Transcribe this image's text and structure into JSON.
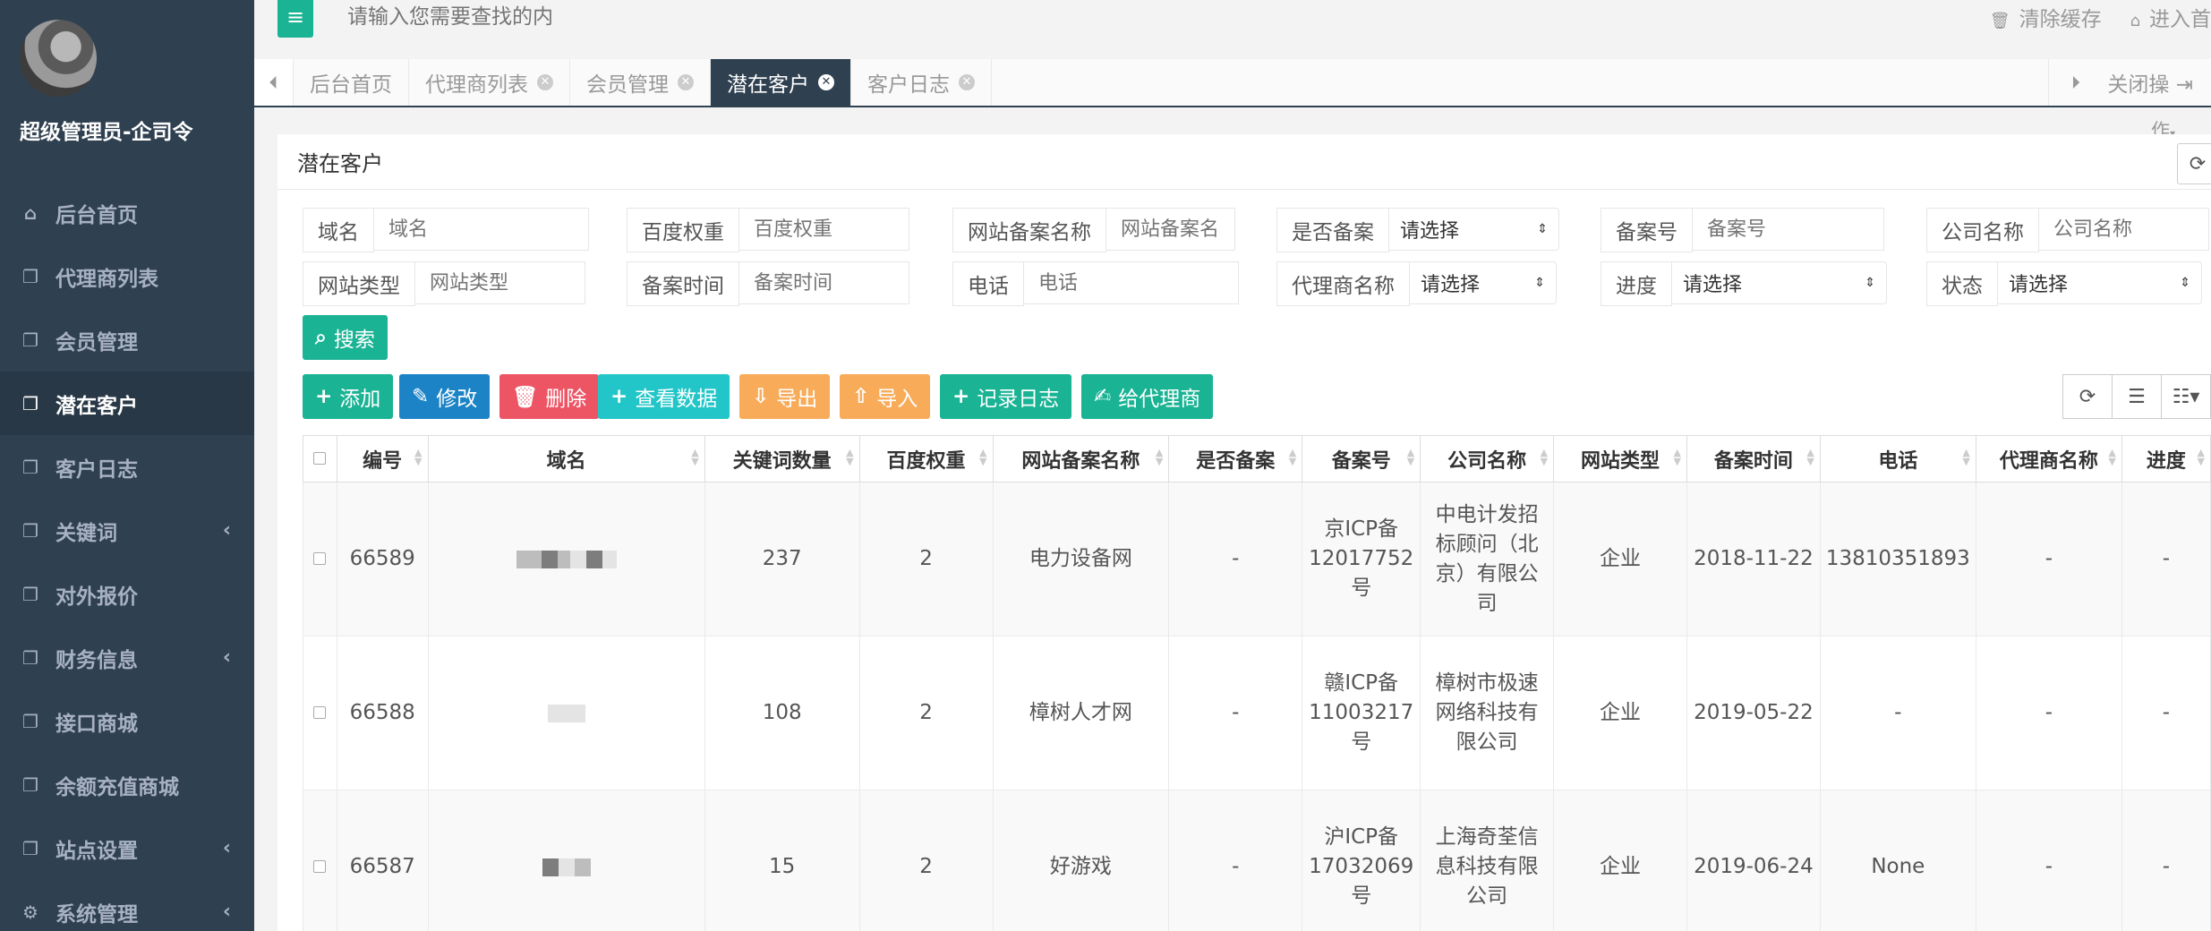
{
  "user": {
    "name": "超级管理员-企司令"
  },
  "sidebar": {
    "items": [
      {
        "label": "后台首页",
        "icon": "home-icon",
        "glyph": "⌂",
        "active": false,
        "has_children": false
      },
      {
        "label": "代理商列表",
        "icon": "copy-icon",
        "glyph": "❐",
        "active": false,
        "has_children": false
      },
      {
        "label": "会员管理",
        "icon": "copy-icon",
        "glyph": "❐",
        "active": false,
        "has_children": false
      },
      {
        "label": "潜在客户",
        "icon": "copy-icon",
        "glyph": "❐",
        "active": true,
        "has_children": false
      },
      {
        "label": "客户日志",
        "icon": "copy-icon",
        "glyph": "❐",
        "active": false,
        "has_children": false
      },
      {
        "label": "关键词",
        "icon": "copy-icon",
        "glyph": "❐",
        "active": false,
        "has_children": true
      },
      {
        "label": "对外报价",
        "icon": "copy-icon",
        "glyph": "❐",
        "active": false,
        "has_children": false
      },
      {
        "label": "财务信息",
        "icon": "copy-icon",
        "glyph": "❐",
        "active": false,
        "has_children": true
      },
      {
        "label": "接口商城",
        "icon": "copy-icon",
        "glyph": "❐",
        "active": false,
        "has_children": false
      },
      {
        "label": "余额充值商城",
        "icon": "copy-icon",
        "glyph": "❐",
        "active": false,
        "has_children": false
      },
      {
        "label": "站点设置",
        "icon": "copy-icon",
        "glyph": "❐",
        "active": false,
        "has_children": true
      },
      {
        "label": "系统管理",
        "icon": "cogs-icon",
        "glyph": "⚙",
        "active": false,
        "has_children": true
      }
    ]
  },
  "topbar": {
    "search_placeholder": "请输入您需要查找的内",
    "clear_cache": "清除缓存",
    "enter_home": "进入首"
  },
  "tabs": [
    {
      "label": "后台首页",
      "closable": false,
      "active": false
    },
    {
      "label": "代理商列表",
      "closable": true,
      "active": false
    },
    {
      "label": "会员管理",
      "closable": true,
      "active": false
    },
    {
      "label": "潜在客户",
      "closable": true,
      "active": true
    },
    {
      "label": "客户日志",
      "closable": true,
      "active": false
    }
  ],
  "tabbar": {
    "close_ops": "关闭操",
    "close_ops_cont": "作"
  },
  "panel": {
    "title": "潜在客户"
  },
  "filters": {
    "domain": {
      "label": "域名",
      "placeholder": "域名"
    },
    "baidu_weight": {
      "label": "百度权重",
      "placeholder": "百度权重"
    },
    "site_name": {
      "label": "网站备案名称",
      "placeholder": "网站备案名称"
    },
    "is_filed": {
      "label": "是否备案",
      "value": "请选择"
    },
    "filing_no": {
      "label": "备案号",
      "placeholder": "备案号"
    },
    "company": {
      "label": "公司名称",
      "placeholder": "公司名称"
    },
    "site_type": {
      "label": "网站类型",
      "placeholder": "网站类型"
    },
    "filing_time": {
      "label": "备案时间",
      "placeholder": "备案时间"
    },
    "phone": {
      "label": "电话",
      "placeholder": "电话"
    },
    "agent_name": {
      "label": "代理商名称",
      "value": "请选择"
    },
    "progress": {
      "label": "进度",
      "value": "请选择"
    },
    "status": {
      "label": "状态",
      "value": "请选择"
    }
  },
  "buttons": {
    "search": "搜索",
    "add": "添加",
    "edit": "修改",
    "delete": "删除",
    "view_data": "查看数据",
    "export": "导出",
    "import": "导入",
    "record_log": "记录日志",
    "to_agent": "给代理商"
  },
  "table": {
    "columns": [
      "编号",
      "域名",
      "关键词数量",
      "百度权重",
      "网站备案名称",
      "是否备案",
      "备案号",
      "公司名称",
      "网站类型",
      "备案时间",
      "电话",
      "代理商名称",
      "进度"
    ],
    "rows": [
      {
        "id": "66589",
        "keywords": "237",
        "weight": "2",
        "site_name": "电力设备网",
        "filed": "-",
        "filing_no": "京ICP备12017752号",
        "company": "中电计发招标顾问（北京）有限公司",
        "type": "企业",
        "time": "2018-11-22",
        "phone": "13810351893",
        "agent": "-",
        "progress": "-"
      },
      {
        "id": "66588",
        "keywords": "108",
        "weight": "2",
        "site_name": "樟树人才网",
        "filed": "-",
        "filing_no": "赣ICP备11003217号",
        "company": "樟树市极速网络科技有限公司",
        "type": "企业",
        "time": "2019-05-22",
        "phone": "-",
        "agent": "-",
        "progress": "-"
      },
      {
        "id": "66587",
        "keywords": "15",
        "weight": "2",
        "site_name": "好游戏",
        "filed": "-",
        "filing_no": "沪ICP备17032069号",
        "company": "上海奇荃信息科技有限公司",
        "type": "企业",
        "time": "2019-06-24",
        "phone": "None",
        "agent": "-",
        "progress": "-"
      }
    ]
  },
  "colors": {
    "sidebar_bg": "#2f4050",
    "primary": "#1ab394",
    "info": "#1c84c6",
    "danger": "#ed5565",
    "cyan": "#23c6c8",
    "warning": "#f8ac59"
  }
}
